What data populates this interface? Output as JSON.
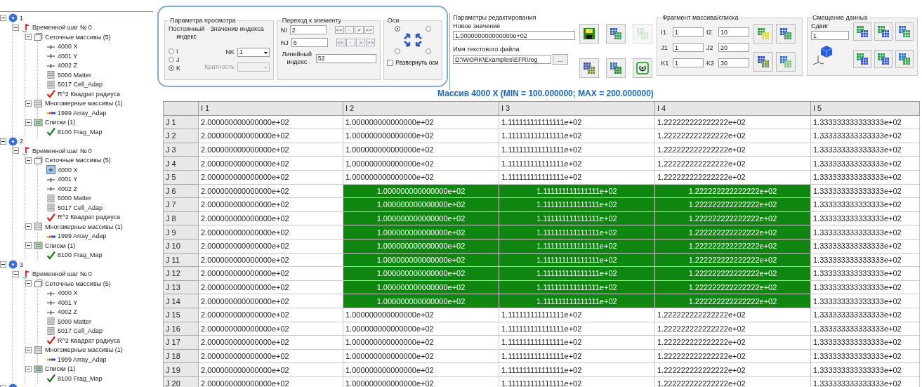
{
  "tree": [
    {
      "label": "1",
      "kind": "root",
      "expanded": true,
      "children": [
        {
          "label": "Временной шаг № 0",
          "kind": "step",
          "expanded": true,
          "children": [
            {
              "label": "Сеточные массивы (5)",
              "kind": "group-grid",
              "expanded": true,
              "children": [
                {
                  "label": "4000 X",
                  "kind": "axis"
                },
                {
                  "label": "4001 Y",
                  "kind": "axis"
                },
                {
                  "label": "4002 Z",
                  "kind": "axis"
                },
                {
                  "label": "5000 Matter",
                  "kind": "matrix"
                },
                {
                  "label": "5017 Cell_Adap",
                  "kind": "matrix"
                },
                {
                  "label": "R^2 Квадрат радиуса",
                  "kind": "check-red"
                }
              ]
            },
            {
              "label": "Многомерные массивы (1)",
              "kind": "group-multi",
              "expanded": true,
              "children": [
                {
                  "label": "1999 Array_Adap",
                  "kind": "multi"
                }
              ]
            },
            {
              "label": "Списки (1)",
              "kind": "group-list",
              "expanded": true,
              "children": [
                {
                  "label": "8100 Frag_Map",
                  "kind": "check-green"
                }
              ]
            }
          ]
        }
      ]
    },
    {
      "label": "2",
      "kind": "root",
      "expanded": true,
      "children": [
        {
          "label": "Временной шаг № 0",
          "kind": "step",
          "expanded": true,
          "children": [
            {
              "label": "Сеточные массивы (5)",
              "kind": "group-grid",
              "expanded": true,
              "children": [
                {
                  "label": "4000 X",
                  "kind": "axis-open"
                },
                {
                  "label": "4001 Y",
                  "kind": "axis"
                },
                {
                  "label": "4002 Z",
                  "kind": "axis"
                },
                {
                  "label": "5000 Matter",
                  "kind": "matrix"
                },
                {
                  "label": "5017 Cell_Adap",
                  "kind": "matrix"
                },
                {
                  "label": "R^2 Квадрат радиуса",
                  "kind": "check-red"
                }
              ]
            },
            {
              "label": "Многомерные массивы (1)",
              "kind": "group-multi",
              "expanded": true,
              "children": [
                {
                  "label": "1999 Array_Adap",
                  "kind": "multi"
                }
              ]
            },
            {
              "label": "Списки (1)",
              "kind": "group-list",
              "expanded": true,
              "children": [
                {
                  "label": "8100 Frag_Map",
                  "kind": "check-green"
                }
              ]
            }
          ]
        }
      ]
    },
    {
      "label": "3",
      "kind": "root",
      "expanded": true,
      "children": [
        {
          "label": "Временной шаг № 0",
          "kind": "step",
          "expanded": true,
          "children": [
            {
              "label": "Сеточные массивы (5)",
              "kind": "group-grid",
              "expanded": true,
              "children": [
                {
                  "label": "4000 X",
                  "kind": "axis"
                },
                {
                  "label": "4001 Y",
                  "kind": "axis"
                },
                {
                  "label": "4002 Z",
                  "kind": "axis"
                },
                {
                  "label": "5000 Matter",
                  "kind": "matrix"
                },
                {
                  "label": "5017 Cell_Adap",
                  "kind": "matrix"
                },
                {
                  "label": "R^2 Квадрат радиуса",
                  "kind": "check-red"
                }
              ]
            },
            {
              "label": "Многомерные массивы (1)",
              "kind": "group-multi",
              "expanded": true,
              "children": [
                {
                  "label": "1999 Array_Adap",
                  "kind": "multi"
                }
              ]
            },
            {
              "label": "Списки (1)",
              "kind": "group-list",
              "expanded": true,
              "children": [
                {
                  "label": "8100 Frag_Map",
                  "kind": "check-green"
                }
              ]
            }
          ]
        }
      ]
    },
    {
      "kind": "root",
      "expanded": true
    }
  ],
  "view_params": {
    "title": "Параметра просмотра",
    "const_label": "Постоянный индекс",
    "value_label": "Значение индекса",
    "radios": [
      {
        "label": "I",
        "selected": false
      },
      {
        "label": "J",
        "selected": false
      },
      {
        "label": "K",
        "selected": true
      }
    ],
    "nk_label": "NK",
    "nk_value": "1",
    "mult_label": "Кратность",
    "mult_disabled": true
  },
  "goto": {
    "title": "Переход к элементу",
    "rows": [
      {
        "label": "NI",
        "value": "2",
        "buttons": [
          {
            "label": "<<",
            "disabled": false
          },
          {
            "label": "<",
            "disabled": true
          },
          {
            "label": ">",
            "disabled": false
          },
          {
            "label": ">>",
            "disabled": false
          }
        ]
      },
      {
        "label": "NJ",
        "value": "6",
        "buttons": [
          {
            "label": "<<",
            "disabled": false
          },
          {
            "label": "<",
            "disabled": true
          },
          {
            "label": ">",
            "disabled": false
          },
          {
            "label": ">>",
            "disabled": false
          }
        ]
      }
    ],
    "linear_label": "Линейный индекс",
    "linear_value": "52"
  },
  "axes": {
    "title": "Оси",
    "corners": [
      {
        "selected": true
      },
      {
        "selected": false
      },
      {
        "selected": false
      },
      {
        "selected": false
      }
    ],
    "flip": {
      "label": "Развернуть оси",
      "checked": false
    }
  },
  "edit": {
    "title": "Параметры редактирования",
    "new_value_label": "Новое значение",
    "new_value": "1.000000000000000e+02",
    "file_label": "Имя текстового файла",
    "file_value": "D:\\WORK\\Examples\\EFR\\reg",
    "browse": "...",
    "buttons": [
      {
        "disabled": false
      },
      {
        "disabled": false
      },
      {
        "disabled": true
      },
      {
        "disabled": false
      },
      {
        "disabled": false
      },
      {
        "disabled": false
      }
    ]
  },
  "fragment": {
    "title": "Фрагмент массива/списка",
    "fields": [
      {
        "label": "I1",
        "value": "1"
      },
      {
        "label": "I2",
        "value": "10"
      },
      {
        "label": "J1",
        "value": "1"
      },
      {
        "label": "J2",
        "value": "20"
      },
      {
        "label": "K1",
        "value": "1"
      },
      {
        "label": "K2",
        "value": "30"
      }
    ]
  },
  "shift": {
    "title": "Смещение данных",
    "label": "Сдвиг",
    "value": "1"
  },
  "array_title": "Массив 4000 X (MIN = 100.000000; MAX = 200.000000)",
  "table": {
    "columns": [
      "I 1",
      "I 2",
      "I 3",
      "I 4",
      "I 5"
    ],
    "rows": [
      {
        "label": "J 1",
        "cells": [
          {
            "text": "2.000000000000000e+02",
            "selected": false
          },
          {
            "text": "1.000000000000000e+02",
            "selected": false
          },
          {
            "text": "1.111111111111111e+02",
            "selected": false
          },
          {
            "text": "1.222222222222222e+02",
            "selected": false
          },
          {
            "text": "1.333333333333333e+02",
            "selected": false
          }
        ]
      },
      {
        "label": "J 2",
        "cells": [
          {
            "text": "2.000000000000000e+02",
            "selected": false
          },
          {
            "text": "1.000000000000000e+02",
            "selected": false
          },
          {
            "text": "1.111111111111111e+02",
            "selected": false
          },
          {
            "text": "1.222222222222222e+02",
            "selected": false
          },
          {
            "text": "1.333333333333333e+02",
            "selected": false
          }
        ]
      },
      {
        "label": "J 3",
        "cells": [
          {
            "text": "2.000000000000000e+02",
            "selected": false
          },
          {
            "text": "1.000000000000000e+02",
            "selected": false
          },
          {
            "text": "1.111111111111111e+02",
            "selected": false
          },
          {
            "text": "1.222222222222222e+02",
            "selected": false
          },
          {
            "text": "1.333333333333333e+02",
            "selected": false
          }
        ]
      },
      {
        "label": "J 4",
        "cells": [
          {
            "text": "2.000000000000000e+02",
            "selected": false
          },
          {
            "text": "1.000000000000000e+02",
            "selected": false
          },
          {
            "text": "1.111111111111111e+02",
            "selected": false
          },
          {
            "text": "1.222222222222222e+02",
            "selected": false
          },
          {
            "text": "1.333333333333333e+02",
            "selected": false
          }
        ]
      },
      {
        "label": "J 5",
        "cells": [
          {
            "text": "2.000000000000000e+02",
            "selected": false
          },
          {
            "text": "1.000000000000000e+02",
            "selected": false
          },
          {
            "text": "1.111111111111111e+02",
            "selected": false
          },
          {
            "text": "1.222222222222222e+02",
            "selected": false
          },
          {
            "text": "1.333333333333333e+02",
            "selected": false
          }
        ]
      },
      {
        "label": "J 6",
        "cells": [
          {
            "text": "2.000000000000000e+02",
            "selected": false
          },
          {
            "text": "1.000000000000000e+02",
            "selected": true
          },
          {
            "text": "1.111111111111111e+02",
            "selected": true
          },
          {
            "text": "1.222222222222222e+02",
            "selected": true
          },
          {
            "text": "1.333333333333333e+02",
            "selected": false
          }
        ]
      },
      {
        "label": "J 7",
        "cells": [
          {
            "text": "2.000000000000000e+02",
            "selected": false
          },
          {
            "text": "1.000000000000000e+02",
            "selected": true
          },
          {
            "text": "1.111111111111111e+02",
            "selected": true
          },
          {
            "text": "1.222222222222222e+02",
            "selected": true
          },
          {
            "text": "1.333333333333333e+02",
            "selected": false
          }
        ]
      },
      {
        "label": "J 8",
        "cells": [
          {
            "text": "2.000000000000000e+02",
            "selected": false
          },
          {
            "text": "1.000000000000000e+02",
            "selected": true
          },
          {
            "text": "1.111111111111111e+02",
            "selected": true
          },
          {
            "text": "1.222222222222222e+02",
            "selected": true
          },
          {
            "text": "1.333333333333333e+02",
            "selected": false
          }
        ]
      },
      {
        "label": "J 9",
        "cells": [
          {
            "text": "2.000000000000000e+02",
            "selected": false
          },
          {
            "text": "1.000000000000000e+02",
            "selected": true
          },
          {
            "text": "1.111111111111111e+02",
            "selected": true
          },
          {
            "text": "1.222222222222222e+02",
            "selected": true
          },
          {
            "text": "1.333333333333333e+02",
            "selected": false
          }
        ]
      },
      {
        "label": "J 10",
        "cells": [
          {
            "text": "2.000000000000000e+02",
            "selected": false
          },
          {
            "text": "1.000000000000000e+02",
            "selected": true
          },
          {
            "text": "1.111111111111111e+02",
            "selected": true
          },
          {
            "text": "1.222222222222222e+02",
            "selected": true
          },
          {
            "text": "1.333333333333333e+02",
            "selected": false
          }
        ]
      },
      {
        "label": "J 11",
        "cells": [
          {
            "text": "2.000000000000000e+02",
            "selected": false
          },
          {
            "text": "1.000000000000000e+02",
            "selected": true
          },
          {
            "text": "1.111111111111111e+02",
            "selected": true
          },
          {
            "text": "1.222222222222222e+02",
            "selected": true
          },
          {
            "text": "1.333333333333333e+02",
            "selected": false
          }
        ]
      },
      {
        "label": "J 12",
        "cells": [
          {
            "text": "2.000000000000000e+02",
            "selected": false
          },
          {
            "text": "1.000000000000000e+02",
            "selected": true
          },
          {
            "text": "1.111111111111111e+02",
            "selected": true
          },
          {
            "text": "1.222222222222222e+02",
            "selected": true
          },
          {
            "text": "1.333333333333333e+02",
            "selected": false
          }
        ]
      },
      {
        "label": "J 13",
        "cells": [
          {
            "text": "2.000000000000000e+02",
            "selected": false
          },
          {
            "text": "1.000000000000000e+02",
            "selected": true
          },
          {
            "text": "1.111111111111111e+02",
            "selected": true
          },
          {
            "text": "1.222222222222222e+02",
            "selected": true
          },
          {
            "text": "1.333333333333333e+02",
            "selected": false
          }
        ]
      },
      {
        "label": "J 14",
        "cells": [
          {
            "text": "2.000000000000000e+02",
            "selected": false
          },
          {
            "text": "1.000000000000000e+02",
            "selected": true
          },
          {
            "text": "1.111111111111111e+02",
            "selected": true
          },
          {
            "text": "1.222222222222222e+02",
            "selected": true
          },
          {
            "text": "1.333333333333333e+02",
            "selected": false
          }
        ]
      },
      {
        "label": "J 15",
        "cells": [
          {
            "text": "2.000000000000000e+02",
            "selected": false
          },
          {
            "text": "1.000000000000000e+02",
            "selected": false
          },
          {
            "text": "1.111111111111111e+02",
            "selected": false
          },
          {
            "text": "1.222222222222222e+02",
            "selected": false
          },
          {
            "text": "1.333333333333333e+02",
            "selected": false
          }
        ]
      },
      {
        "label": "J 16",
        "cells": [
          {
            "text": "2.000000000000000e+02",
            "selected": false
          },
          {
            "text": "1.000000000000000e+02",
            "selected": false
          },
          {
            "text": "1.111111111111111e+02",
            "selected": false
          },
          {
            "text": "1.222222222222222e+02",
            "selected": false
          },
          {
            "text": "1.333333333333333e+02",
            "selected": false
          }
        ]
      },
      {
        "label": "J 17",
        "cells": [
          {
            "text": "2.000000000000000e+02",
            "selected": false
          },
          {
            "text": "1.000000000000000e+02",
            "selected": false
          },
          {
            "text": "1.111111111111111e+02",
            "selected": false
          },
          {
            "text": "1.222222222222222e+02",
            "selected": false
          },
          {
            "text": "1.333333333333333e+02",
            "selected": false
          }
        ]
      },
      {
        "label": "J 18",
        "cells": [
          {
            "text": "2.000000000000000e+02",
            "selected": false
          },
          {
            "text": "1.000000000000000e+02",
            "selected": false
          },
          {
            "text": "1.111111111111111e+02",
            "selected": false
          },
          {
            "text": "1.222222222222222e+02",
            "selected": false
          },
          {
            "text": "1.333333333333333e+02",
            "selected": false
          }
        ]
      },
      {
        "label": "J 19",
        "cells": [
          {
            "text": "2.000000000000000e+02",
            "selected": false
          },
          {
            "text": "1.000000000000000e+02",
            "selected": false
          },
          {
            "text": "1.111111111111111e+02",
            "selected": false
          },
          {
            "text": "1.222222222222222e+02",
            "selected": false
          },
          {
            "text": "1.333333333333333e+02",
            "selected": false
          }
        ]
      },
      {
        "label": "J 20",
        "cells": [
          {
            "text": "2.000000000000000e+02",
            "selected": false
          },
          {
            "text": "1.000000000000000e+02",
            "selected": false
          },
          {
            "text": "1.111111111111111e+02",
            "selected": false
          },
          {
            "text": "1.222222222222222e+02",
            "selected": false
          },
          {
            "text": "1.333333333333333e+02",
            "selected": false
          }
        ]
      }
    ]
  }
}
